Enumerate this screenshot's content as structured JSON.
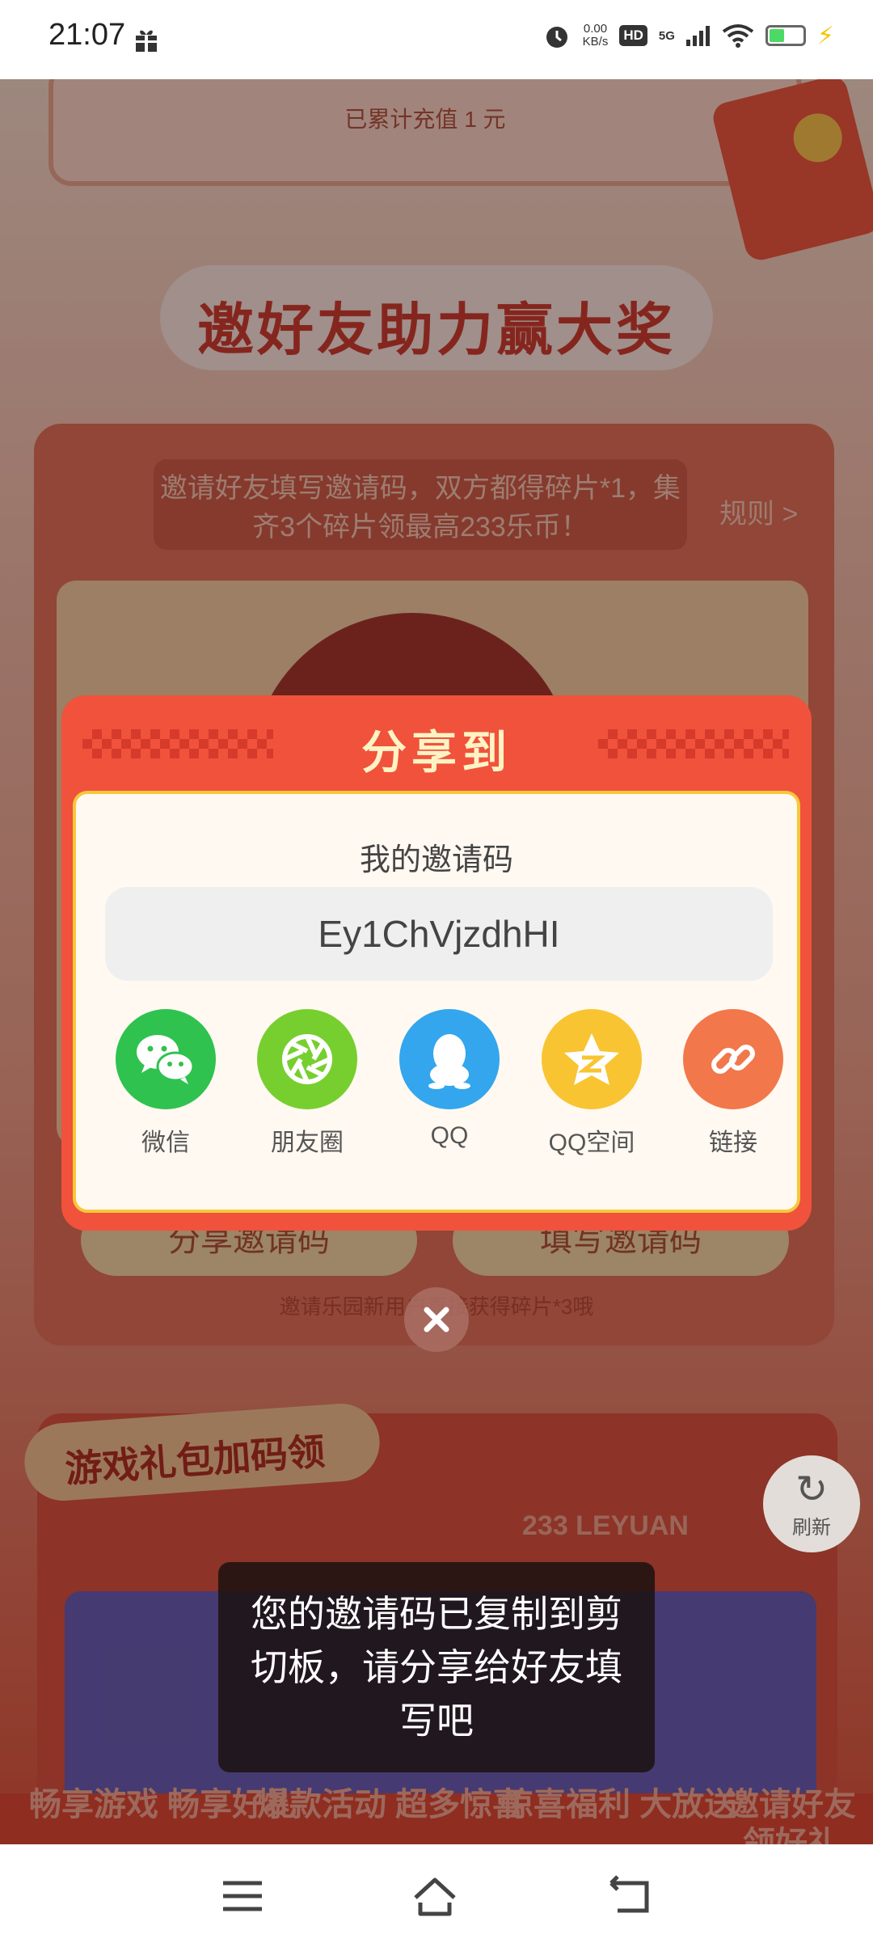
{
  "status_bar": {
    "time": "21:07",
    "net_speed_value": "0.00",
    "net_speed_unit": "KB/s",
    "hd": "HD",
    "signal": "5G"
  },
  "background": {
    "recharge_text": "已累计充值 1 元",
    "invite_title": "邀好友助力赢大奖",
    "invite_notice": "邀请好友填写邀请码，双方都得碎片*1，集齐3个碎片领最高233乐币！",
    "invite_rules": "规则 >",
    "share_code_button": "分享邀请码",
    "fill_code_button": "填写邀请码",
    "invite_hint": "邀请乐园新用户直接获得碎片*3哦",
    "gift_tag": "游戏礼包加码领",
    "gift_brand": "233 LEYUAN",
    "promos": [
      "畅享游戏 畅享好礼",
      "爆款活动 超多惊喜",
      "惊喜福利 大放送",
      "邀请好友 领好礼"
    ],
    "refresh_label": "刷新"
  },
  "share_dialog": {
    "title": "分享到",
    "code_label": "我的邀请码",
    "code_value": "Ey1ChVjzdhHI",
    "options": [
      {
        "label": "微信",
        "icon": "wechat-icon",
        "color": "#2fc24f"
      },
      {
        "label": "朋友圈",
        "icon": "moments-icon",
        "color": "#77cf2f"
      },
      {
        "label": "QQ",
        "icon": "qq-icon",
        "color": "#33a6ee"
      },
      {
        "label": "QQ空间",
        "icon": "qzone-icon",
        "color": "#f9c431"
      },
      {
        "label": "链接",
        "icon": "link-icon",
        "color": "#f2774a"
      }
    ],
    "close_icon": "close-icon"
  },
  "toast": {
    "message": "您的邀请码已复制到剪切板，请分享给好友填写吧"
  },
  "nav_bar": {
    "menu_icon": "menu-icon",
    "home_icon": "home-icon",
    "back_icon": "back-icon"
  },
  "colors": {
    "dialog_red": "#f0523c",
    "dialog_title": "#fff3c4",
    "frame_yellow": "#f6c83a"
  }
}
